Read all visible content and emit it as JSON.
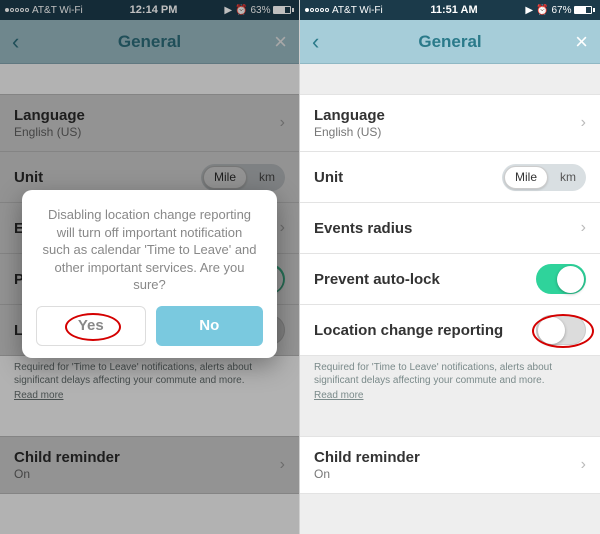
{
  "left": {
    "status": {
      "carrier": "AT&T Wi-Fi",
      "time": "12:14 PM",
      "alarm": "⏰",
      "batt_pct": "63%",
      "batt_fill": 63
    },
    "header": {
      "title": "General"
    },
    "rows": {
      "language": {
        "label": "Language",
        "value": "English (US)"
      },
      "unit": {
        "label": "Unit",
        "opt1": "Mile",
        "opt2": "km"
      },
      "events": {
        "label": "Events radius"
      },
      "prevent": {
        "label": "Prevent auto-lock"
      },
      "loc": {
        "label": "Location change reporting"
      },
      "child": {
        "label": "Child reminder",
        "value": "On"
      }
    },
    "helper": {
      "text": "Required for 'Time to Leave' notifications, alerts about significant delays affecting your commute and more.",
      "readmore": "Read more"
    },
    "dialog": {
      "message": "Disabling location change reporting will turn off important notification such as calendar 'Time to Leave' and other important services.\nAre you sure?",
      "yes": "Yes",
      "no": "No"
    }
  },
  "right": {
    "status": {
      "carrier": "AT&T Wi-Fi",
      "time": "11:51 AM",
      "alarm": "⏰",
      "batt_pct": "67%",
      "batt_fill": 67
    },
    "header": {
      "title": "General"
    },
    "rows": {
      "language": {
        "label": "Language",
        "value": "English (US)"
      },
      "unit": {
        "label": "Unit",
        "opt1": "Mile",
        "opt2": "km"
      },
      "events": {
        "label": "Events radius"
      },
      "prevent": {
        "label": "Prevent auto-lock"
      },
      "loc": {
        "label": "Location change reporting"
      },
      "child": {
        "label": "Child reminder",
        "value": "On"
      }
    },
    "helper": {
      "text": "Required for 'Time to Leave' notifications, alerts about significant delays affecting your commute and more.",
      "readmore": "Read more"
    }
  }
}
